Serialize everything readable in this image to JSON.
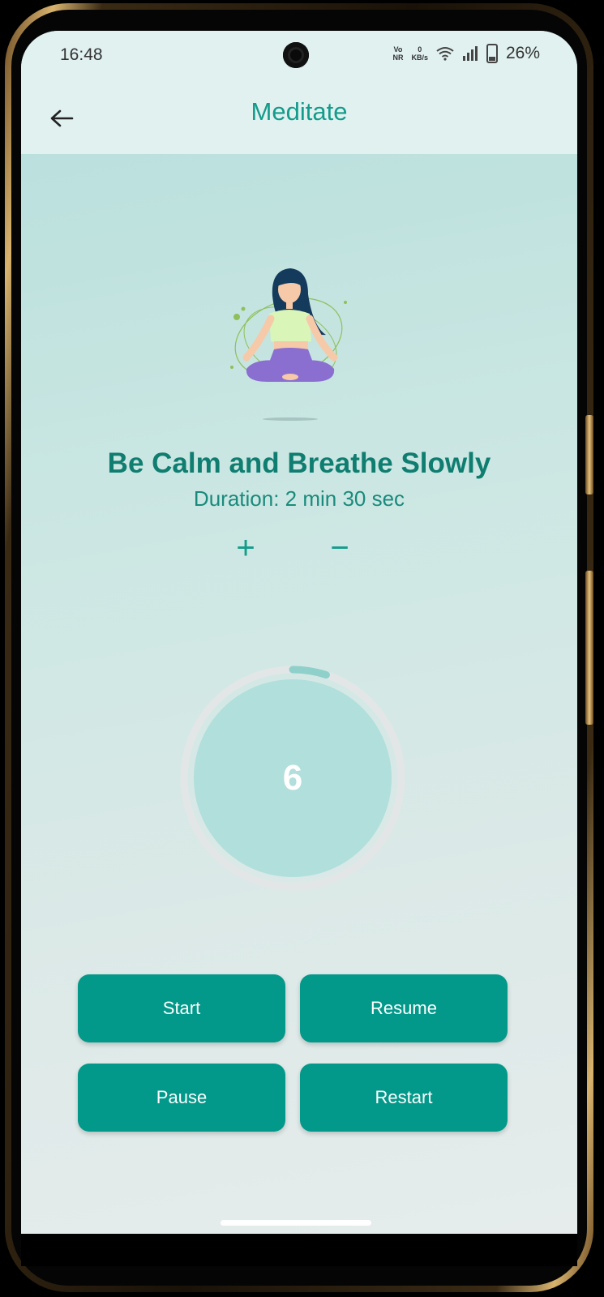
{
  "status_bar": {
    "time": "16:48",
    "volte_top": "Vo",
    "volte_bottom": "NR",
    "speed_value": "0",
    "speed_unit": "KB/s",
    "battery": "26%"
  },
  "app_bar": {
    "title": "Meditate",
    "back_icon": "arrow-left-icon"
  },
  "content": {
    "heading": "Be Calm and Breathe Slowly",
    "duration": "Duration: 2 min 30 sec",
    "increase_label": "+",
    "decrease_label": "−",
    "timer_count": "6",
    "timer_progress": 0.05
  },
  "buttons": {
    "start": "Start",
    "resume": "Resume",
    "pause": "Pause",
    "restart": "Restart"
  },
  "colors": {
    "accent": "#02998a",
    "heading": "#0f7d70",
    "title": "#139b8b",
    "timer_fill": "#b1dfdc",
    "timer_track": "#e3e6e6",
    "timer_progress": "#8fd0ca"
  }
}
